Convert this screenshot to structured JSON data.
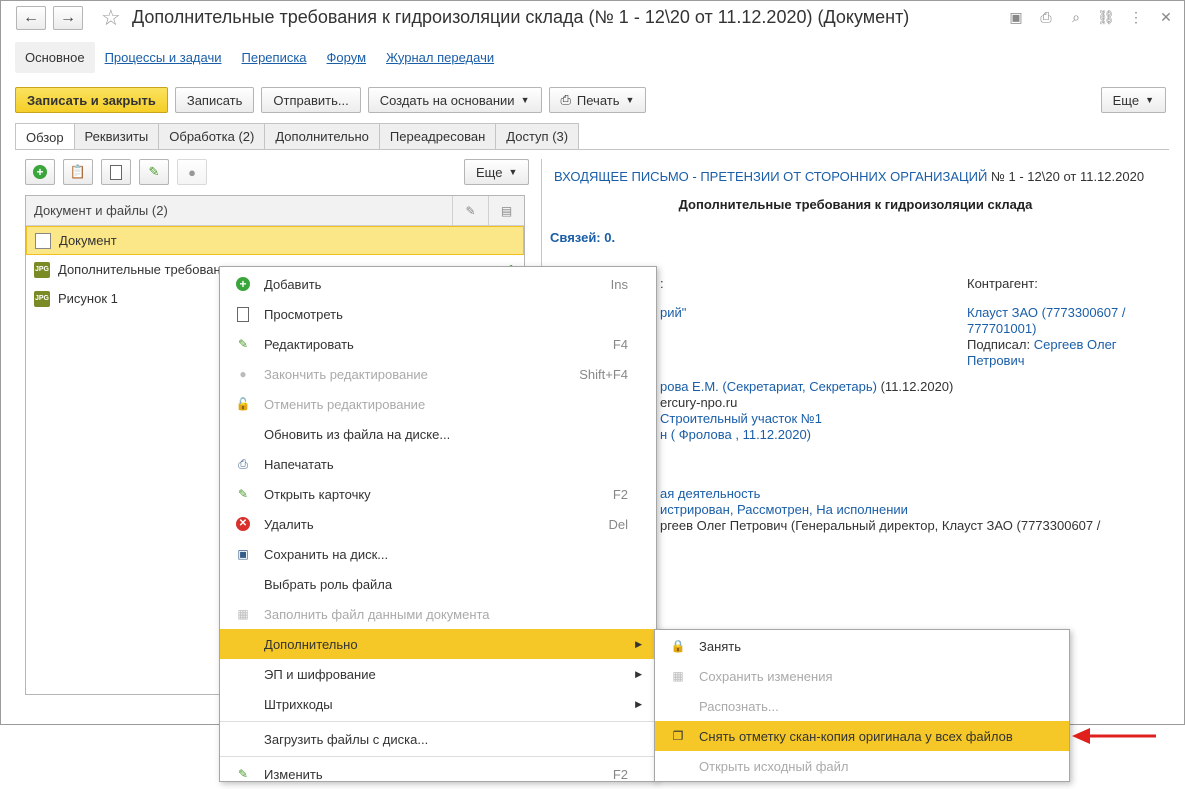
{
  "window": {
    "title": "Дополнительные требования к гидроизоляции склада (№ 1 - 12\\20 от 11.12.2020) (Документ)"
  },
  "sections": [
    {
      "label": "Основное"
    },
    {
      "label": "Процессы и задачи"
    },
    {
      "label": "Переписка"
    },
    {
      "label": "Форум"
    },
    {
      "label": "Журнал передачи"
    }
  ],
  "toolbar": {
    "save_close": "Записать и закрыть",
    "save": "Записать",
    "send": "Отправить...",
    "create_based": "Создать на основании",
    "print": "Печать",
    "more": "Еще"
  },
  "tabs": [
    {
      "label": "Обзор"
    },
    {
      "label": "Реквизиты"
    },
    {
      "label": "Обработка (2)"
    },
    {
      "label": "Дополнительно"
    },
    {
      "label": "Переадресован"
    },
    {
      "label": "Доступ (3)"
    }
  ],
  "files": {
    "more": "Еще",
    "header": "Документ и файлы (2)",
    "rows": [
      {
        "name": "Документ",
        "type": "doc"
      },
      {
        "name": "Дополнительные требования к гидроизоляции склада",
        "type": "JPG"
      },
      {
        "name": "Рисунок 1",
        "type": "JPG"
      }
    ]
  },
  "preview": {
    "kind_link": "ВХОДЯЩЕЕ ПИСЬМО",
    "dash": " - ",
    "type_link": "ПРЕТЕНЗИИ ОТ СТОРОННИХ ОРГАНИЗАЦИЙ",
    "number": " № 1 - 12\\20 от 11.12.2020",
    "title": "Дополнительные требования к гидроизоляции склада",
    "links": "Связей: 0.",
    "fragment_colon": ":",
    "contractor_label": "Контрагент:",
    "org_fragment": "рий\"",
    "contractor_line1": "Клауст ЗАО (7773300607 /",
    "contractor_line2": "777701001)",
    "signed_label": "Подписал:",
    "signed_by_1": "Сергеев Олег",
    "signed_by_2": "Петрович",
    "registered_fragment": "рова Е.М. (Секретариат, Секретарь)",
    "registered_date": " (11.12.2020)",
    "email_fragment": "ercury-npo.ru",
    "site_fragment": "Строительный участок №1",
    "reviewer_fragment": "н ( Фролова , 11.12.2020)",
    "activity_fragment": "ая деятельность",
    "status_fragment": "истрирован, Рассмотрен, На исполнении",
    "addressee_fragment": "ргеев Олег Петрович (Генеральный директор, Клауст ЗАО (7773300607 /"
  },
  "context_menu": [
    {
      "label": "Добавить",
      "shortcut": "Ins",
      "icon": "add-icon",
      "disabled": false
    },
    {
      "label": "Просмотреть",
      "shortcut": "",
      "icon": "page-icon",
      "disabled": false
    },
    {
      "label": "Редактировать",
      "shortcut": "F4",
      "icon": "edit-icon",
      "disabled": false
    },
    {
      "label": "Закончить редактирование",
      "shortcut": "Shift+F4",
      "icon": "finish-edit-icon",
      "disabled": true
    },
    {
      "label": "Отменить редактирование",
      "shortcut": "",
      "icon": "unlock-icon",
      "disabled": true
    },
    {
      "label": "Обновить из файла на диске...",
      "shortcut": "",
      "icon": "",
      "disabled": false
    },
    {
      "label": "Напечатать",
      "shortcut": "",
      "icon": "printer-icon",
      "disabled": false
    },
    {
      "label": "Открыть карточку",
      "shortcut": "F2",
      "icon": "pencil-icon",
      "disabled": false
    },
    {
      "label": "Удалить",
      "shortcut": "Del",
      "icon": "delete-icon",
      "disabled": false
    },
    {
      "label": "Сохранить на диск...",
      "shortcut": "",
      "icon": "save-icon",
      "disabled": false
    },
    {
      "label": "Выбрать роль файла",
      "shortcut": "",
      "icon": "",
      "disabled": false
    },
    {
      "label": "Заполнить файл данными документа",
      "shortcut": "",
      "icon": "fill-icon",
      "disabled": true
    },
    {
      "label": "Дополнительно",
      "shortcut": "",
      "icon": "",
      "disabled": false,
      "submenu": true,
      "highlighted": true
    },
    {
      "label": "ЭП и шифрование",
      "shortcut": "",
      "icon": "",
      "disabled": false,
      "submenu": true
    },
    {
      "label": "Штрихкоды",
      "shortcut": "",
      "icon": "",
      "disabled": false,
      "submenu": true
    },
    {
      "label": "Загрузить файлы с диска...",
      "shortcut": "",
      "icon": "",
      "disabled": false,
      "separator_before": true
    },
    {
      "label": "Изменить",
      "shortcut": "F2",
      "icon": "pencil-icon",
      "disabled": false,
      "separator_before": true
    }
  ],
  "submenu": [
    {
      "label": "Занять",
      "icon": "lock-icon",
      "disabled": false
    },
    {
      "label": "Сохранить изменения",
      "icon": "save-changes-icon",
      "disabled": true
    },
    {
      "label": "Распознать...",
      "icon": "",
      "disabled": true
    },
    {
      "label": "Снять отметку скан-копия оригинала у всех файлов",
      "icon": "copy-icon",
      "disabled": false,
      "highlighted": true
    },
    {
      "label": "Открыть исходный файл",
      "icon": "",
      "disabled": true
    }
  ],
  "colors": {
    "accent": "#f5c827",
    "link": "#1a5ea8",
    "annotation_arrow": "#e0201c"
  }
}
